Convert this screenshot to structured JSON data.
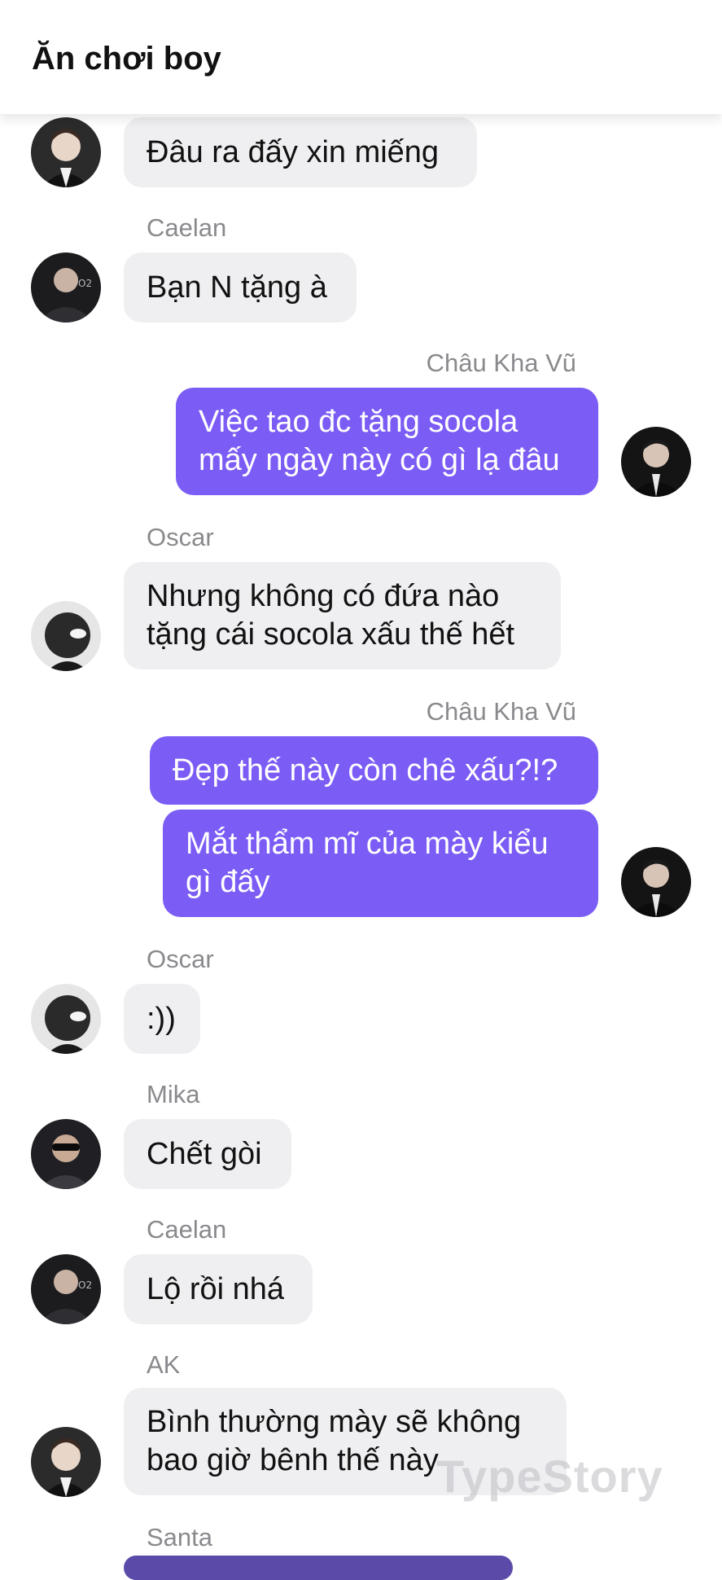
{
  "header": {
    "title": "Ăn chơi boy"
  },
  "messages": [
    {
      "text": "Đâu ra đấy xin miếng"
    },
    {
      "sender": "Caelan",
      "text": "Bạn N tặng à"
    },
    {
      "sender": "Châu Kha Vũ",
      "text": "Việc tao đc tặng socola\nmấy ngày này có gì lạ đâu"
    },
    {
      "sender": "Oscar",
      "text": "Nhưng không có đứa nào\ntặng cái socola xấu thế hết"
    },
    {
      "sender": "Châu Kha Vũ",
      "text": "Đẹp thế này còn chê xấu?!?"
    },
    {
      "text": "Mắt thẩm mĩ của mày kiểu\ngì đấy"
    },
    {
      "sender": "Oscar",
      "text": ":))"
    },
    {
      "sender": "Mika",
      "text": "Chết gòi"
    },
    {
      "sender": "Caelan",
      "text": "Lộ rồi nhá"
    },
    {
      "sender": "AK",
      "text": "Bình thường mày sẽ không\nbao giờ bênh thế này"
    },
    {
      "sender": "Santa"
    }
  ],
  "watermark": "TypeStory",
  "colors": {
    "outgoing_bubble": "#7b5cf5",
    "incoming_bubble": "#efeff1",
    "sender_name": "#8a8a8e"
  }
}
